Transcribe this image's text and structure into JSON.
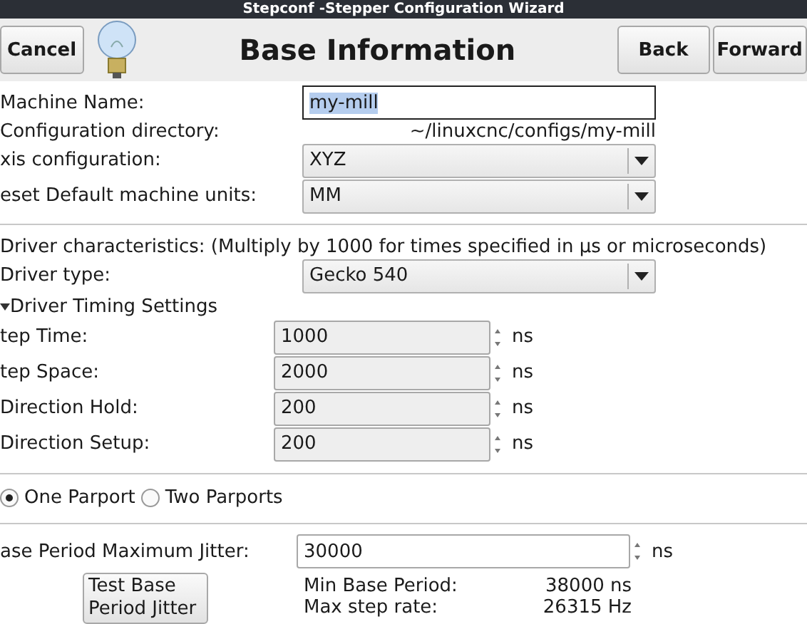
{
  "window": {
    "title": "Stepconf -Stepper Configuration Wizard"
  },
  "header": {
    "cancel": "Cancel",
    "title": "Base Information",
    "back": "Back",
    "forward": "Forward"
  },
  "base": {
    "machine_name": {
      "label": "Machine Name:",
      "value": "my-mill",
      "text_selected": true
    },
    "config_dir": {
      "label": "Configuration directory:",
      "value": "~/linuxcnc/configs/my-mill"
    },
    "axis": {
      "label": "xis configuration:",
      "value": "XYZ"
    },
    "units": {
      "label": "eset Default machine units:",
      "value": "MM"
    }
  },
  "driver": {
    "heading": "Driver characteristics: (Multiply by 1000 for times specified in µs or microseconds)",
    "type": {
      "label": "Driver type:",
      "value": "Gecko 540"
    },
    "timing": {
      "label": "Driver Timing Settings",
      "expanded": true,
      "fields": [
        {
          "label": "tep Time:",
          "value": "1000",
          "unit": "ns"
        },
        {
          "label": "tep Space:",
          "value": "2000",
          "unit": "ns"
        },
        {
          "label": "Direction Hold:",
          "value": "200",
          "unit": "ns"
        },
        {
          "label": "Direction Setup:",
          "value": "200",
          "unit": "ns"
        }
      ]
    }
  },
  "parports": [
    {
      "label": "One Parport",
      "selected": true
    },
    {
      "label": "Two Parports",
      "selected": false
    }
  ],
  "jitter": {
    "label": "ase Period Maximum Jitter:",
    "value": "30000",
    "unit": "ns",
    "test_button": "Test Base Period Jitter",
    "stats": [
      {
        "label": "Min Base Period:",
        "value": "38000 ns"
      },
      {
        "label": "Max step rate:",
        "value": "26315 Hz"
      }
    ]
  }
}
